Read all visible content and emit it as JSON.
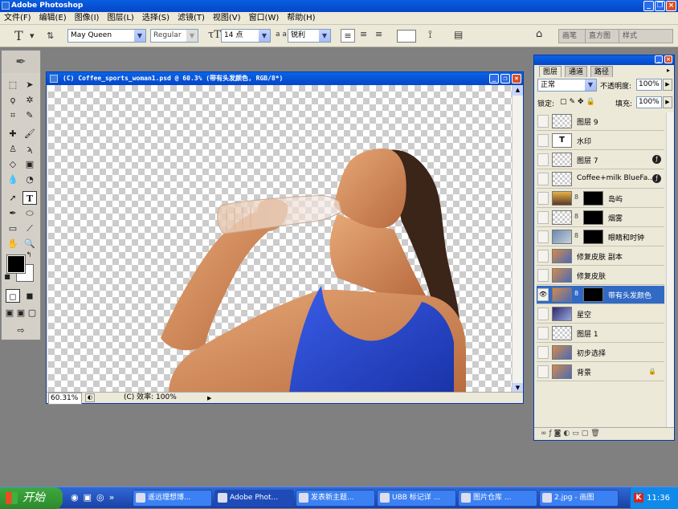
{
  "app": {
    "title": "Adobe Photoshop"
  },
  "menu": [
    "文件(F)",
    "编辑(E)",
    "图像(I)",
    "图层(L)",
    "选择(S)",
    "滤镜(T)",
    "视图(V)",
    "窗口(W)",
    "帮助(H)"
  ],
  "options": {
    "font_family": "May Queen",
    "font_style": "Regular",
    "font_size": "14 点",
    "aa_label": "a a",
    "aa_value": "锐利"
  },
  "palette_well": [
    "画笔",
    "直方图",
    "样式"
  ],
  "document": {
    "title": "(C) Coffee_sports_woman1.psd @ 60.3% (带有头发颜色, RGB/8*)",
    "zoom": "60.31%",
    "status": "(C) 效率: 100%"
  },
  "layers_panel": {
    "tabs": [
      "图层",
      "通道",
      "路径"
    ],
    "blend_mode": "正常",
    "opacity_label": "不透明度:",
    "opacity": "100%",
    "lock_label": "锁定:",
    "fill_label": "填充:",
    "fill": "100%",
    "layers": [
      {
        "name": "图层 9"
      },
      {
        "name": "水印"
      },
      {
        "name": "图层 7"
      },
      {
        "name": "Coffee+milk BlueFa..."
      },
      {
        "name": "岛屿"
      },
      {
        "name": "烟雾"
      },
      {
        "name": "眼睛和时钟"
      },
      {
        "name": "修复皮肤 副本"
      },
      {
        "name": "修复皮肤"
      },
      {
        "name": "带有头发颜色"
      },
      {
        "name": "星空"
      },
      {
        "name": "图层 1"
      },
      {
        "name": "初步选择"
      },
      {
        "name": "背景"
      }
    ]
  },
  "taskbar": {
    "start": "开始",
    "tasks": [
      "遥远理想博...",
      "Adobe Phot...",
      "发表新主题...",
      "UBB 标记详 ...",
      "图片仓库 ...",
      "2.jpg - 画图"
    ],
    "clock": "11:36"
  },
  "colors": {
    "titlebar": "#0546c8",
    "selected_layer": "#316ac5",
    "taskbar": "#245edb",
    "start": "#2f9a2f"
  }
}
